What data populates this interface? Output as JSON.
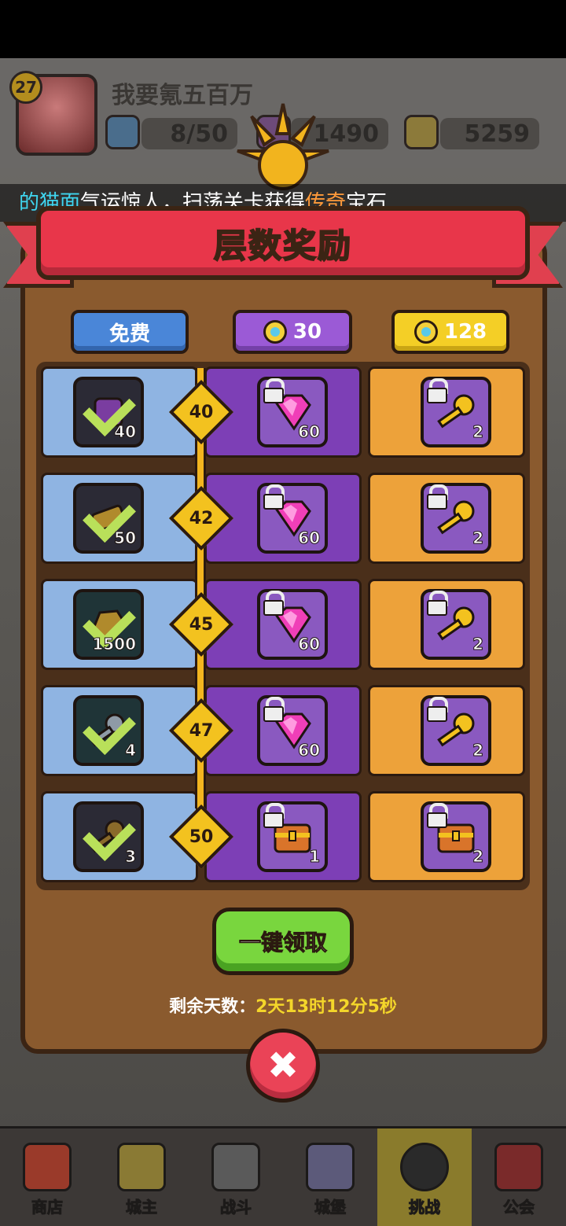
{
  "player": {
    "level": "27",
    "name": "我要氪五百万",
    "energy": "8/50",
    "gems": "1490",
    "gold": "5259"
  },
  "ticker": {
    "part1": "的猫面",
    "part2": "气运惊人，扫荡关卡获得",
    "part3": "传奇",
    "part4": "宝石"
  },
  "panel": {
    "title": "层数奖励",
    "tiers": {
      "free": "免费",
      "mid_price": "30",
      "top_price": "128"
    },
    "rows": [
      {
        "floor": "40",
        "free_count": "40",
        "mid_count": "60",
        "top_count": "2"
      },
      {
        "floor": "42",
        "free_count": "50",
        "mid_count": "60",
        "top_count": "2"
      },
      {
        "floor": "45",
        "free_count": "1500",
        "mid_count": "60",
        "top_count": "2"
      },
      {
        "floor": "47",
        "free_count": "4",
        "mid_count": "60",
        "top_count": "2"
      },
      {
        "floor": "50",
        "free_count": "3",
        "mid_count": "1",
        "top_count": "2"
      }
    ],
    "claim_label": "一键领取",
    "remaining_label": "剩余天数：",
    "remaining_value": "2天13时12分5秒"
  },
  "nav": {
    "items": [
      {
        "label": "商店",
        "icon": "shop-icon"
      },
      {
        "label": "城主",
        "icon": "crown-icon"
      },
      {
        "label": "战斗",
        "icon": "swords-icon"
      },
      {
        "label": "城堡",
        "icon": "castle-icon"
      },
      {
        "label": "挑战",
        "icon": "demon-icon"
      },
      {
        "label": "公会",
        "icon": "guild-banner-icon"
      }
    ]
  },
  "colors": {
    "free": "#8fb4e2",
    "premium": "#7d3fb6",
    "elite": "#eda23a",
    "banner": "#e8364a",
    "claim": "#79d63e"
  }
}
